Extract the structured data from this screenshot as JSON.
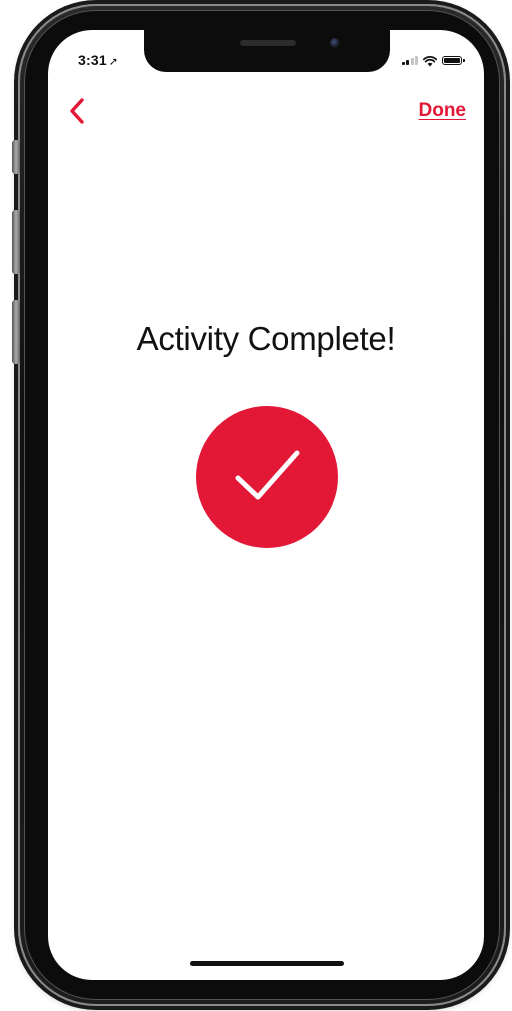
{
  "status_bar": {
    "time": "3:31",
    "location_icon": "location-arrow-icon",
    "signal_icon": "cellular-signal-icon",
    "wifi_icon": "wifi-icon",
    "battery_icon": "battery-icon"
  },
  "nav": {
    "back_icon": "chevron-left-icon",
    "done_label": "Done"
  },
  "main": {
    "title": "Activity Complete!",
    "status_icon": "checkmark-icon"
  },
  "colors": {
    "accent": "#e31837",
    "text": "#111111",
    "background": "#ffffff"
  }
}
